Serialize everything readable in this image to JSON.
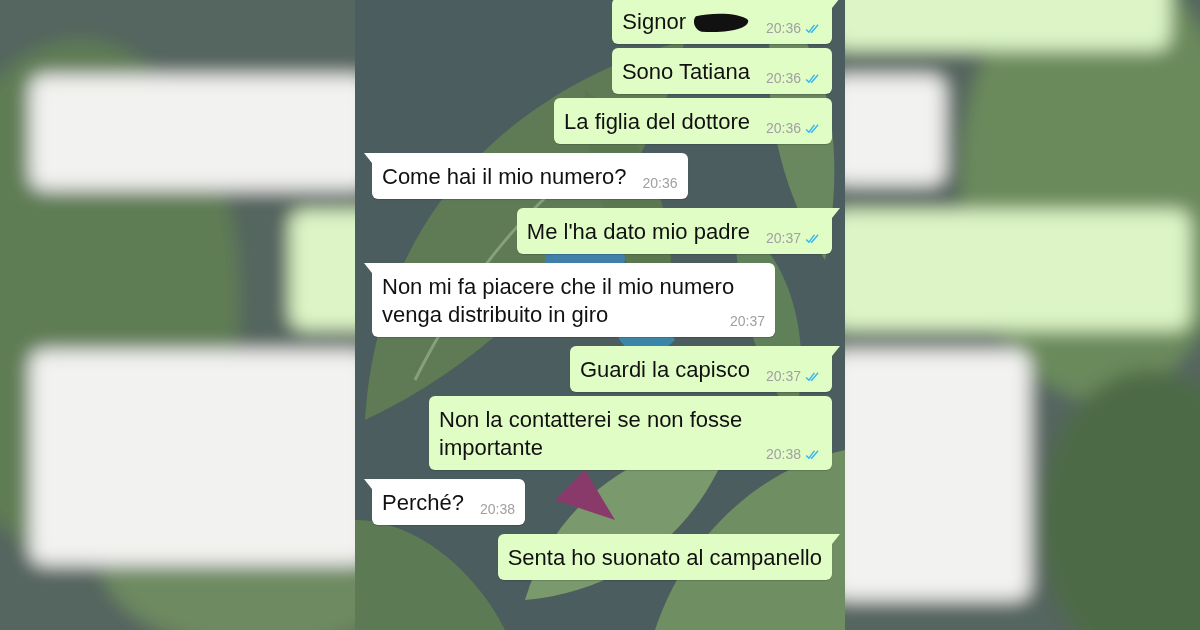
{
  "messages": [
    {
      "kind": "out",
      "text": "Signor",
      "redacted": true,
      "time": "20:36",
      "read": true,
      "tail": true
    },
    {
      "kind": "out",
      "text": "Sono Tatiana",
      "time": "20:36",
      "read": true,
      "tail": false
    },
    {
      "kind": "out",
      "text": "La figlia del dottore",
      "time": "20:36",
      "read": true,
      "tail": false
    },
    {
      "kind": "in",
      "text": "Come hai il mio numero?",
      "time": "20:36",
      "tail": true
    },
    {
      "kind": "out",
      "text": "Me l'ha dato mio padre",
      "time": "20:37",
      "read": true,
      "tail": true
    },
    {
      "kind": "in",
      "text": "Non mi fa piacere che il mio numero venga distribuito in giro",
      "time": "20:37",
      "tail": true
    },
    {
      "kind": "out",
      "text": "Guardi la capisco",
      "time": "20:37",
      "read": true,
      "tail": true
    },
    {
      "kind": "out",
      "text": "Non la contatterei se non fosse importante",
      "time": "20:38",
      "read": true,
      "tail": false
    },
    {
      "kind": "in",
      "text": "Perché?",
      "time": "20:38",
      "tail": true
    },
    {
      "kind": "out",
      "text": "Senta ho suonato al campanello",
      "tail": true
    }
  ]
}
